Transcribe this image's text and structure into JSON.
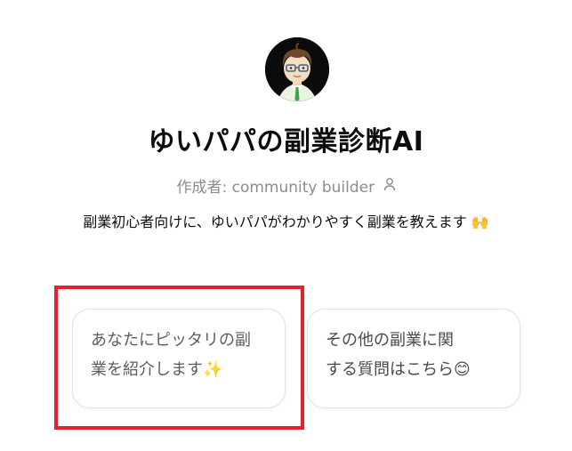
{
  "gpt": {
    "title": "ゆいパパの副業診断AI",
    "author_prefix": "作成者: ",
    "author_name": "community builder",
    "description": "副業初心者向けに、ゆいパパがわかりやすく副業を教えます 🙌"
  },
  "conversation_starters": [
    {
      "line1": "あなたにピッタリの副",
      "line2": "業を紹介します✨"
    },
    {
      "line1": "その他の副業に関",
      "line2": "する質問はこちら😊"
    }
  ],
  "icons": {
    "avatar": "avatar-image",
    "author": "person-icon"
  },
  "colors": {
    "highlight": "#e3202b",
    "muted_text": "#8c8c8c",
    "card_border": "#e3e3e3"
  }
}
